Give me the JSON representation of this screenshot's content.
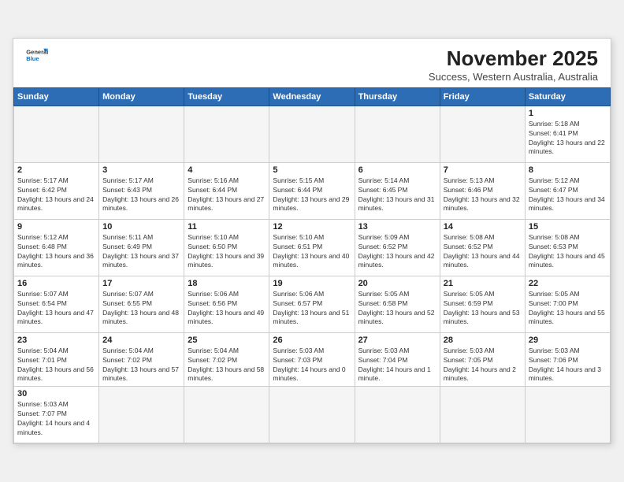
{
  "header": {
    "logo_general": "General",
    "logo_blue": "Blue",
    "month_title": "November 2025",
    "subtitle": "Success, Western Australia, Australia"
  },
  "weekdays": [
    "Sunday",
    "Monday",
    "Tuesday",
    "Wednesday",
    "Thursday",
    "Friday",
    "Saturday"
  ],
  "days": [
    {
      "num": "",
      "empty": true
    },
    {
      "num": "",
      "empty": true
    },
    {
      "num": "",
      "empty": true
    },
    {
      "num": "",
      "empty": true
    },
    {
      "num": "",
      "empty": true
    },
    {
      "num": "",
      "empty": true
    },
    {
      "num": "1",
      "sunrise": "5:18 AM",
      "sunset": "6:41 PM",
      "daylight": "13 hours and 22 minutes."
    },
    {
      "num": "2",
      "sunrise": "5:17 AM",
      "sunset": "6:42 PM",
      "daylight": "13 hours and 24 minutes."
    },
    {
      "num": "3",
      "sunrise": "5:17 AM",
      "sunset": "6:43 PM",
      "daylight": "13 hours and 26 minutes."
    },
    {
      "num": "4",
      "sunrise": "5:16 AM",
      "sunset": "6:44 PM",
      "daylight": "13 hours and 27 minutes."
    },
    {
      "num": "5",
      "sunrise": "5:15 AM",
      "sunset": "6:44 PM",
      "daylight": "13 hours and 29 minutes."
    },
    {
      "num": "6",
      "sunrise": "5:14 AM",
      "sunset": "6:45 PM",
      "daylight": "13 hours and 31 minutes."
    },
    {
      "num": "7",
      "sunrise": "5:13 AM",
      "sunset": "6:46 PM",
      "daylight": "13 hours and 32 minutes."
    },
    {
      "num": "8",
      "sunrise": "5:12 AM",
      "sunset": "6:47 PM",
      "daylight": "13 hours and 34 minutes."
    },
    {
      "num": "9",
      "sunrise": "5:12 AM",
      "sunset": "6:48 PM",
      "daylight": "13 hours and 36 minutes."
    },
    {
      "num": "10",
      "sunrise": "5:11 AM",
      "sunset": "6:49 PM",
      "daylight": "13 hours and 37 minutes."
    },
    {
      "num": "11",
      "sunrise": "5:10 AM",
      "sunset": "6:50 PM",
      "daylight": "13 hours and 39 minutes."
    },
    {
      "num": "12",
      "sunrise": "5:10 AM",
      "sunset": "6:51 PM",
      "daylight": "13 hours and 40 minutes."
    },
    {
      "num": "13",
      "sunrise": "5:09 AM",
      "sunset": "6:52 PM",
      "daylight": "13 hours and 42 minutes."
    },
    {
      "num": "14",
      "sunrise": "5:08 AM",
      "sunset": "6:52 PM",
      "daylight": "13 hours and 44 minutes."
    },
    {
      "num": "15",
      "sunrise": "5:08 AM",
      "sunset": "6:53 PM",
      "daylight": "13 hours and 45 minutes."
    },
    {
      "num": "16",
      "sunrise": "5:07 AM",
      "sunset": "6:54 PM",
      "daylight": "13 hours and 47 minutes."
    },
    {
      "num": "17",
      "sunrise": "5:07 AM",
      "sunset": "6:55 PM",
      "daylight": "13 hours and 48 minutes."
    },
    {
      "num": "18",
      "sunrise": "5:06 AM",
      "sunset": "6:56 PM",
      "daylight": "13 hours and 49 minutes."
    },
    {
      "num": "19",
      "sunrise": "5:06 AM",
      "sunset": "6:57 PM",
      "daylight": "13 hours and 51 minutes."
    },
    {
      "num": "20",
      "sunrise": "5:05 AM",
      "sunset": "6:58 PM",
      "daylight": "13 hours and 52 minutes."
    },
    {
      "num": "21",
      "sunrise": "5:05 AM",
      "sunset": "6:59 PM",
      "daylight": "13 hours and 53 minutes."
    },
    {
      "num": "22",
      "sunrise": "5:05 AM",
      "sunset": "7:00 PM",
      "daylight": "13 hours and 55 minutes."
    },
    {
      "num": "23",
      "sunrise": "5:04 AM",
      "sunset": "7:01 PM",
      "daylight": "13 hours and 56 minutes."
    },
    {
      "num": "24",
      "sunrise": "5:04 AM",
      "sunset": "7:02 PM",
      "daylight": "13 hours and 57 minutes."
    },
    {
      "num": "25",
      "sunrise": "5:04 AM",
      "sunset": "7:02 PM",
      "daylight": "13 hours and 58 minutes."
    },
    {
      "num": "26",
      "sunrise": "5:03 AM",
      "sunset": "7:03 PM",
      "daylight": "14 hours and 0 minutes."
    },
    {
      "num": "27",
      "sunrise": "5:03 AM",
      "sunset": "7:04 PM",
      "daylight": "14 hours and 1 minute."
    },
    {
      "num": "28",
      "sunrise": "5:03 AM",
      "sunset": "7:05 PM",
      "daylight": "14 hours and 2 minutes."
    },
    {
      "num": "29",
      "sunrise": "5:03 AM",
      "sunset": "7:06 PM",
      "daylight": "14 hours and 3 minutes."
    },
    {
      "num": "30",
      "sunrise": "5:03 AM",
      "sunset": "7:07 PM",
      "daylight": "14 hours and 4 minutes."
    },
    {
      "num": "",
      "empty": true
    },
    {
      "num": "",
      "empty": true
    },
    {
      "num": "",
      "empty": true
    },
    {
      "num": "",
      "empty": true
    },
    {
      "num": "",
      "empty": true
    },
    {
      "num": "",
      "empty": true
    }
  ]
}
